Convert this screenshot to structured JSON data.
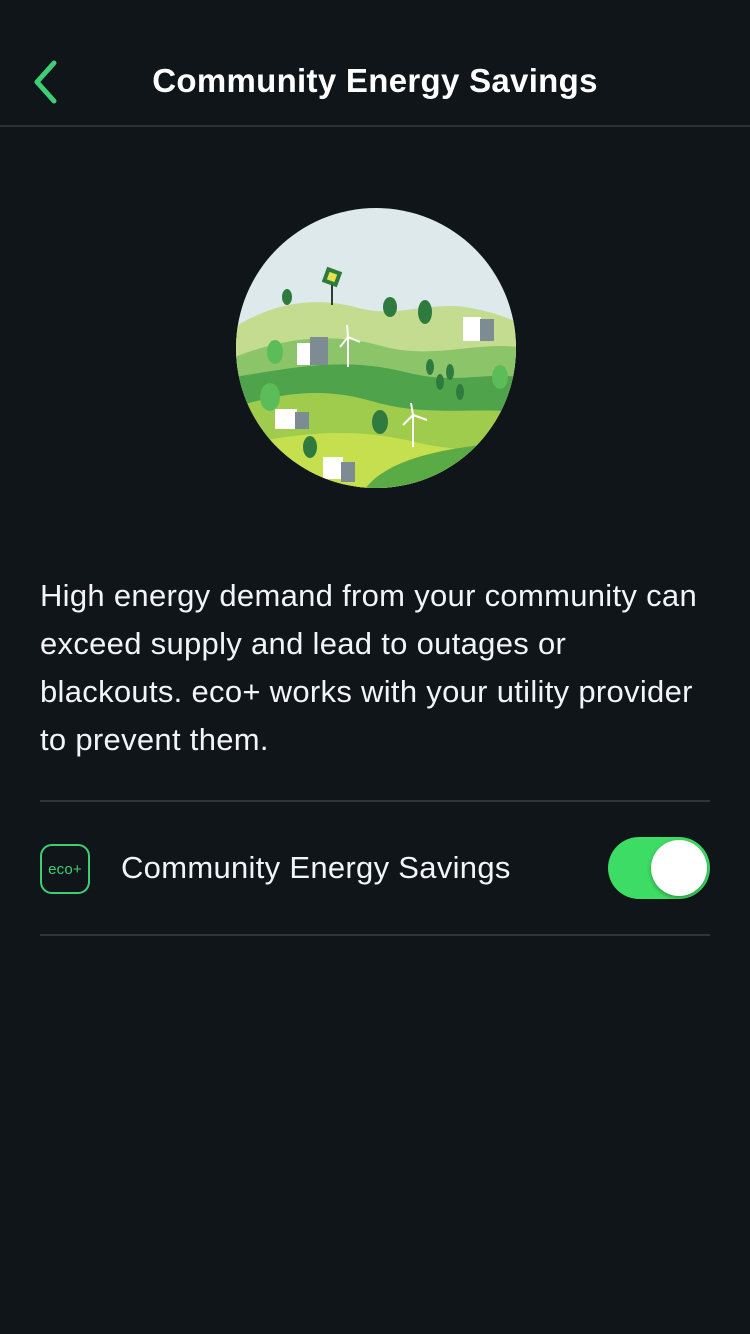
{
  "header": {
    "title": "Community Energy Savings",
    "back_icon": "chevron-left-icon"
  },
  "illustration": {
    "icon": "community-landscape-illustration"
  },
  "description": "High energy demand from your community can exceed supply and lead to outages or blackouts. eco+ works with your utility provider to prevent them.",
  "setting": {
    "badge_text": "eco+",
    "label": "Community Energy Savings",
    "toggle_on": true
  },
  "colors": {
    "background": "#10151a",
    "accent_green": "#3ecf74",
    "toggle_green": "#3ddc64"
  }
}
